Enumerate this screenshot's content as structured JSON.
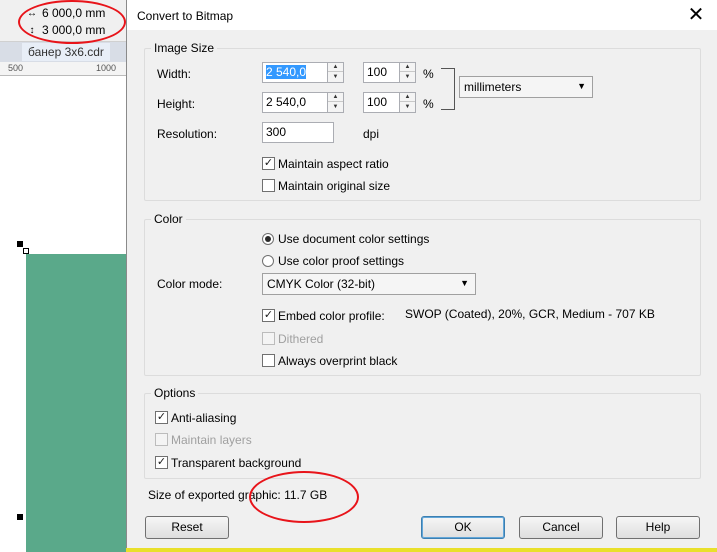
{
  "background": {
    "width_value": "6 000,0 mm",
    "height_value": "3 000,0 mm",
    "doc_tab": "банер 3х6.cdr",
    "ruler_ticks": [
      "500",
      "1000"
    ],
    "annotation_color": "#e8141a",
    "canvas_rect_color": "#5aa98a"
  },
  "dialog": {
    "title": "Convert to Bitmap",
    "close_glyph": "✕",
    "image_size": {
      "legend": "Image Size",
      "width_label": "Width:",
      "width_value": "2 540,0",
      "width_percent": "100",
      "height_label": "Height:",
      "height_value": "2 540,0",
      "height_percent": "100",
      "percent_sign": "%",
      "units": "millimeters",
      "resolution_label": "Resolution:",
      "resolution_value": "300",
      "resolution_unit": "dpi",
      "maintain_aspect_label": "Maintain aspect ratio",
      "maintain_aspect_checked": true,
      "maintain_original_label": "Maintain original size",
      "maintain_original_checked": false
    },
    "color": {
      "legend": "Color",
      "use_document_label": "Use document color settings",
      "use_proof_label": "Use color proof settings",
      "selected": "document",
      "mode_label": "Color mode:",
      "mode_value": "CMYK Color (32-bit)",
      "embed_profile_label": "Embed color profile:",
      "embed_profile_checked": true,
      "profile_name": "SWOP (Coated), 20%, GCR, Medium - 707 KB",
      "dithered_label": "Dithered",
      "always_overprint_label": "Always overprint black"
    },
    "options": {
      "legend": "Options",
      "anti_aliasing_label": "Anti-aliasing",
      "maintain_layers_label": "Maintain layers",
      "transparent_bg_label": "Transparent background"
    },
    "export_size_label": "Size of exported graphic: 11.7 GB",
    "buttons": {
      "reset": "Reset",
      "ok": "OK",
      "cancel": "Cancel",
      "help": "Help"
    }
  }
}
